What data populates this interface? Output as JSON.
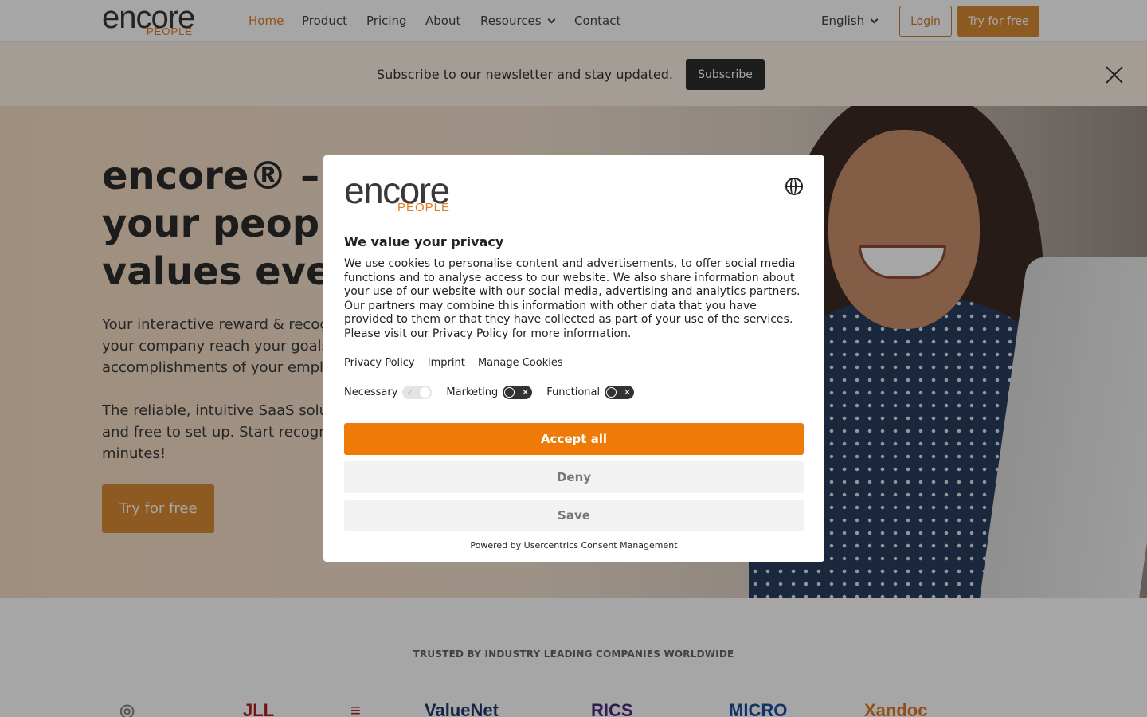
{
  "nav": {
    "logo_word": "encore",
    "logo_sub": "PEOPLE",
    "links": [
      {
        "label": "Home",
        "active": true
      },
      {
        "label": "Product"
      },
      {
        "label": "Pricing"
      },
      {
        "label": "About"
      },
      {
        "label": "Resources",
        "has_dropdown": true
      },
      {
        "label": "Contact"
      }
    ],
    "language": "English",
    "login_label": "Login",
    "try_label": "Try for free"
  },
  "newsletter": {
    "text": "Subscribe to our newsletter and stay updated.",
    "button_label": "Subscribe"
  },
  "hero": {
    "title_lines": [
      "encore® – C",
      "your people",
      "values ever"
    ],
    "para1_lines": [
      "Your interactive reward & recog",
      "your company reach your goals",
      "accomplishments of your empl"
    ],
    "para2_lines": [
      "The reliable, intuitive SaaS solu",
      "and free to set up. Start recogn",
      "minutes!"
    ],
    "cta_label": "Try for free"
  },
  "trusted": {
    "title": "TRUSTED BY INDUSTRY LEADING COMPANIES WORLDWIDE",
    "logos": [
      "JLL",
      "ValueNet",
      "RICS",
      "MICRO",
      "Xandoc"
    ]
  },
  "consent": {
    "logo_word": "encore",
    "logo_sub": "PEOPLE",
    "title": "We value your privacy",
    "body_lines": [
      "We use cookies to personalise content and advertisements, to offer social media",
      "functions and to analyse access to our website. We also share information about",
      "your use of our website with our social media, advertising and analytics partners.",
      "Our partners may combine this information with other data that you have",
      "provided to them or that they have collected as part of your use of the services.",
      "Please visit our Privacy Policy for more information."
    ],
    "links": [
      "Privacy Policy",
      "Imprint",
      "Manage Cookies"
    ],
    "toggles": [
      {
        "label": "Necessary",
        "on": true
      },
      {
        "label": "Marketing",
        "on": false
      },
      {
        "label": "Functional",
        "on": false
      }
    ],
    "accept_label": "Accept all",
    "deny_label": "Deny",
    "save_label": "Save",
    "powered_by": "Powered by Usercentrics Consent Management"
  },
  "colors": {
    "brand_orange": "#ee7b08",
    "cta_orange": "#d98a35",
    "dark": "#2d2d2d"
  }
}
